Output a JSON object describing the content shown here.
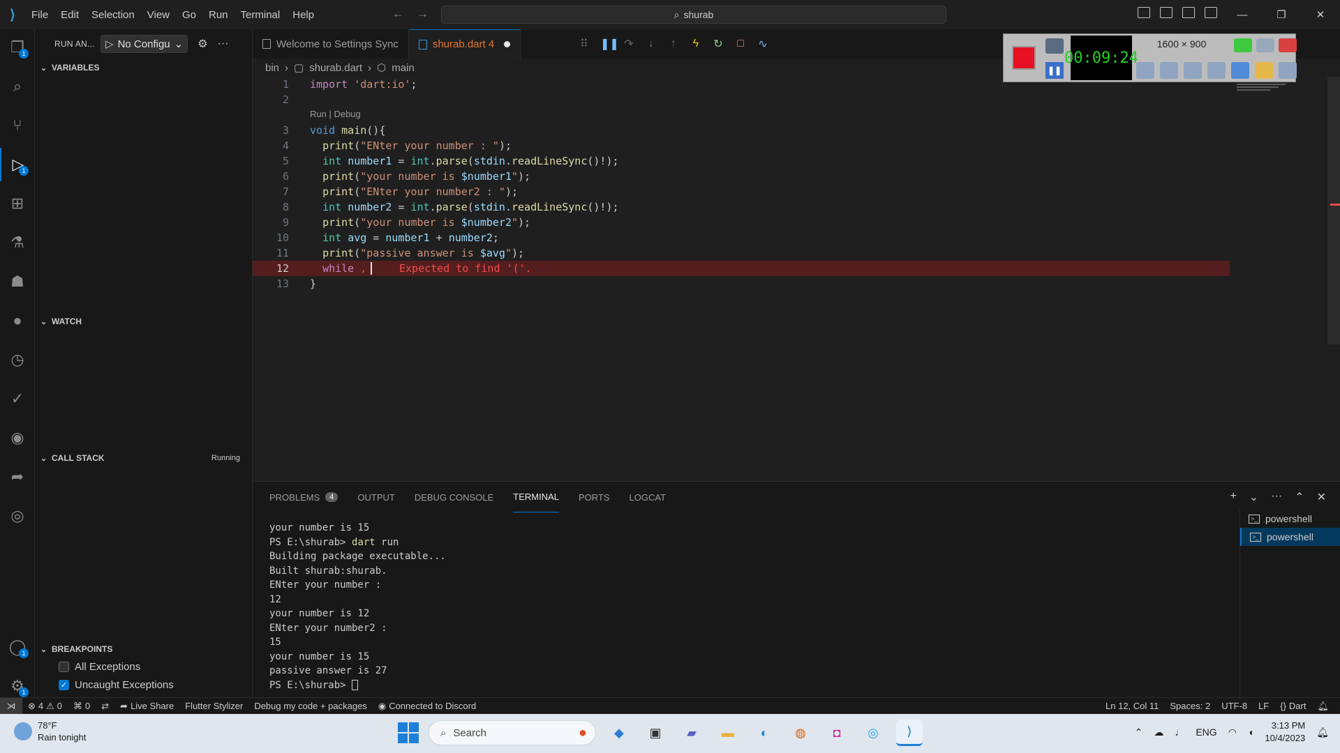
{
  "titlebar": {
    "menu": [
      "File",
      "Edit",
      "Selection",
      "View",
      "Go",
      "Run",
      "Terminal",
      "Help"
    ],
    "search_text": "shurab"
  },
  "sidebar": {
    "run_label": "RUN AN...",
    "config_label": "No Configu",
    "sections": {
      "variables": "VARIABLES",
      "watch": "WATCH",
      "call_stack": "CALL STACK",
      "call_stack_status": "Running",
      "breakpoints": "BREAKPOINTS"
    },
    "breakpoints": [
      {
        "label": "All Exceptions",
        "checked": false
      },
      {
        "label": "Uncaught Exceptions",
        "checked": true
      }
    ]
  },
  "tabs": [
    {
      "label": "Welcome to Settings Sync",
      "active": false
    },
    {
      "label": "shurab.dart 4",
      "active": true,
      "dirty": true
    }
  ],
  "breadcrumb": [
    "bin",
    "shurab.dart",
    "main"
  ],
  "editor": {
    "codelens": "Run | Debug",
    "lines": [
      {
        "n": "1",
        "code": "import 'dart:io';"
      },
      {
        "n": "2",
        "code": ""
      },
      {
        "n": "3",
        "code": "void main(){"
      },
      {
        "n": "4",
        "code": "  print(\"ENter your number : \");"
      },
      {
        "n": "5",
        "code": "  int number1 = int.parse(stdin.readLineSync()!);"
      },
      {
        "n": "6",
        "code": "  print(\"your number is $number1\");"
      },
      {
        "n": "7",
        "code": "  print(\"ENter your number2 : \");"
      },
      {
        "n": "8",
        "code": "  int number2 = int.parse(stdin.readLineSync()!);"
      },
      {
        "n": "9",
        "code": "  print(\"your number is $number2\");"
      },
      {
        "n": "10",
        "code": "  int avg = number1 + number2;"
      },
      {
        "n": "11",
        "code": "  print(\"passive answer is $avg\");"
      },
      {
        "n": "12",
        "code": "  while ,"
      },
      {
        "n": "13",
        "code": "}"
      }
    ],
    "error_message": "Expected to find '('."
  },
  "recorder": {
    "timer": "00:09:24",
    "resolution": "1600 × 900"
  },
  "panel": {
    "tabs": [
      {
        "label": "PROBLEMS",
        "count": "4"
      },
      {
        "label": "OUTPUT"
      },
      {
        "label": "DEBUG CONSOLE"
      },
      {
        "label": "TERMINAL",
        "active": true
      },
      {
        "label": "PORTS"
      },
      {
        "label": "LOGCAT"
      }
    ],
    "terminal_lines": [
      "your number is 15",
      "PS E:\\shurab> dart run",
      "Building package executable...",
      "Built shurab:shurab.",
      "ENter your number :",
      "12",
      "your number is 12",
      "ENter your number2 :",
      "15",
      "your number is 15",
      "passive answer is 27",
      "PS E:\\shurab> "
    ],
    "terminals": [
      "powershell",
      "powershell"
    ]
  },
  "statusbar": {
    "errors": "4",
    "warnings": "0",
    "ports": "0",
    "live_share": "Live Share",
    "flutter_stylizer": "Flutter Stylizer",
    "debug_mode": "Debug my code + packages",
    "discord": "Connected to Discord",
    "position": "Ln 12, Col 11",
    "spaces": "Spaces: 2",
    "encoding": "UTF-8",
    "eol": "LF",
    "language": "Dart"
  },
  "taskbar": {
    "temperature": "78°F",
    "forecast": "Rain tonight",
    "search_placeholder": "Search",
    "lang": "ENG",
    "time": "3:13 PM",
    "date": "10/4/2023"
  },
  "colors": {
    "accent": "#0078d4",
    "error": "#f14c4c",
    "editor_bg": "#1f1f1f"
  }
}
